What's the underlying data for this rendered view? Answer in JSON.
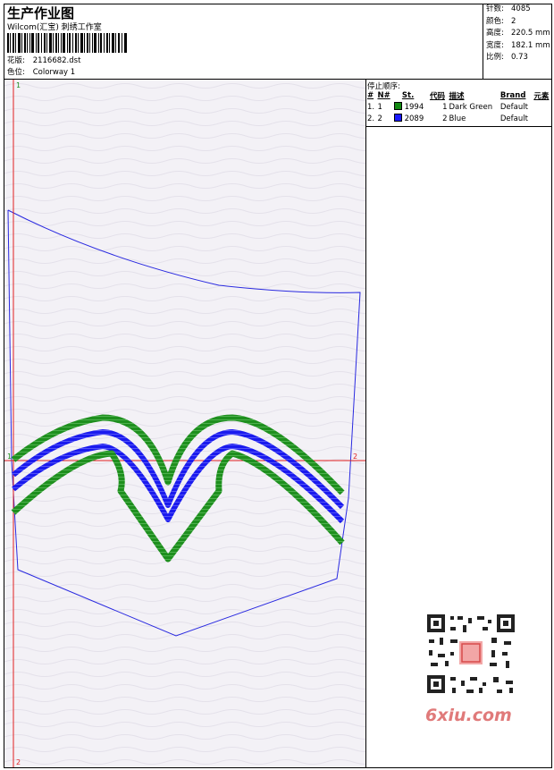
{
  "header": {
    "title": "生产作业图",
    "company": "Wilcom(汇宝) 刺绣工作室",
    "file_label": "花版:",
    "file_name": "2116682.dst",
    "colorway_label": "色位:",
    "colorway_name": "Colorway 1"
  },
  "stats": [
    {
      "label": "针数:",
      "value": "4085"
    },
    {
      "label": "颜色:",
      "value": "2"
    },
    {
      "label": "高度:",
      "value": "220.5 mm"
    },
    {
      "label": "宽度:",
      "value": "182.1 mm"
    },
    {
      "label": "比例:",
      "value": "0.73"
    }
  ],
  "stop_sequence": {
    "title": "停止顺序:",
    "columns": [
      "#",
      "N#",
      "St.",
      "代码",
      "描述",
      "Brand",
      "元素"
    ],
    "rows": [
      {
        "index": "1.",
        "n": "1",
        "stitches": "1994",
        "code": "1",
        "description": "Dark Green",
        "brand": "Default",
        "swatch": "#138a13"
      },
      {
        "index": "2.",
        "n": "2",
        "stitches": "2089",
        "code": "2",
        "description": "Blue",
        "brand": "Default",
        "swatch": "#1a1aff"
      }
    ]
  },
  "axis_markers": {
    "top": "1",
    "bottom": "2",
    "left": "1",
    "right": "2"
  },
  "colors": {
    "green": "#1e8f1e",
    "blue": "#1a1aee",
    "outline": "#2a2ae0",
    "axis": "#e02020"
  },
  "watermark": {
    "text": "6xiu.com"
  }
}
